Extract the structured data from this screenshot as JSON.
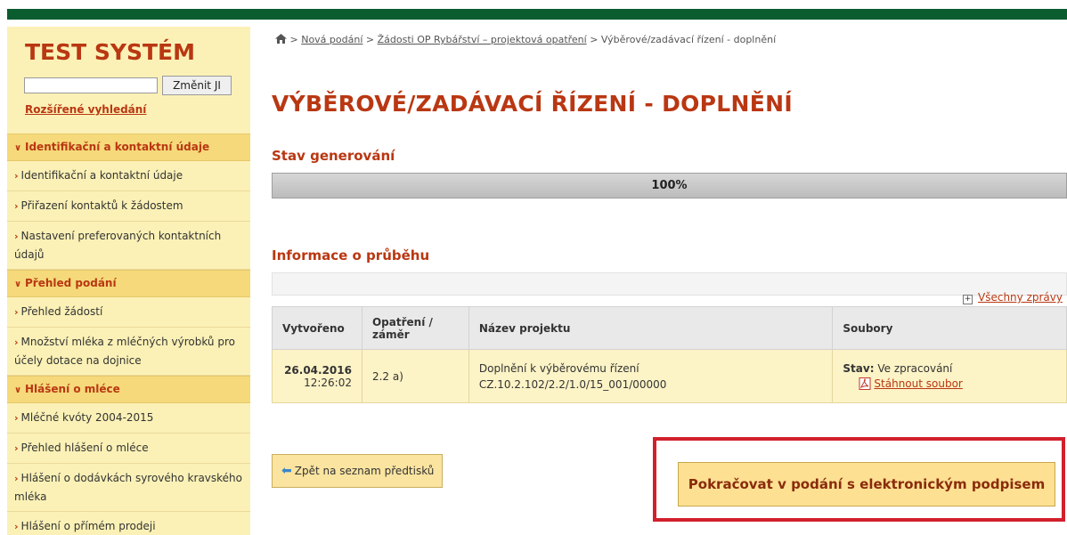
{
  "logo": "TEST SYSTÉM",
  "search": {
    "value": "",
    "button": "Změnit JI",
    "advanced": "Rozšířené vyhledání"
  },
  "menu": [
    {
      "type": "cat",
      "label": "Identifikační a kontaktní údaje"
    },
    {
      "type": "item",
      "label": "Identifikační a kontaktní údaje"
    },
    {
      "type": "item",
      "label": "Přiřazení kontaktů k žádostem"
    },
    {
      "type": "item",
      "label": "Nastavení preferovaných kontaktních údajů"
    },
    {
      "type": "cat",
      "label": "Přehled podání"
    },
    {
      "type": "item",
      "label": "Přehled žádostí"
    },
    {
      "type": "item",
      "label": "Množství mléka z mléčných výrobků pro účely dotace na dojnice"
    },
    {
      "type": "cat",
      "label": "Hlášení o mléce"
    },
    {
      "type": "item",
      "label": "Mléčné kvóty 2004-2015"
    },
    {
      "type": "item",
      "label": "Přehled hlášení o mléce"
    },
    {
      "type": "item",
      "label": "Hlášení o dodávkách syrového kravského mléka"
    },
    {
      "type": "item",
      "label": "Hlášení o přímém prodeji"
    }
  ],
  "breadcrumb": {
    "sep": ">",
    "links": [
      "Nová podání",
      "Žádosti OP Rybářství – projektová opatření"
    ],
    "current": "Výběrové/zadávací řízení - doplnění"
  },
  "page_title": "VÝBĚROVÉ/ZADÁVACÍ ŘÍZENÍ - DOPLNĚNÍ",
  "generation": {
    "heading": "Stav generování",
    "progress": 100,
    "progress_label": "100%"
  },
  "info": {
    "heading": "Informace o průběhu",
    "all_messages": "Všechny zprávy"
  },
  "table": {
    "headers": [
      "Vytvořeno",
      "Opatření / záměr",
      "Název projektu",
      "Soubory"
    ],
    "row": {
      "date": "26.04.2016",
      "time": "12:26:02",
      "measure": "2.2 a)",
      "project_line1": "Doplnění k výběrovému řízení",
      "project_line2": "CZ.10.2.102/2.2/1.0/15_001/00000",
      "status_label": "Stav:",
      "status_value": "Ve zpracování",
      "download": "Stáhnout soubor"
    }
  },
  "buttons": {
    "back": "Zpět na seznam předtisků",
    "continue": "Pokračovat v podání s elektronickým podpisem"
  },
  "colors": {
    "accent": "#b93712",
    "topbar": "#0b5c2e",
    "sidebar_bg": "#fbf1b6",
    "highlight": "#d2202c"
  }
}
